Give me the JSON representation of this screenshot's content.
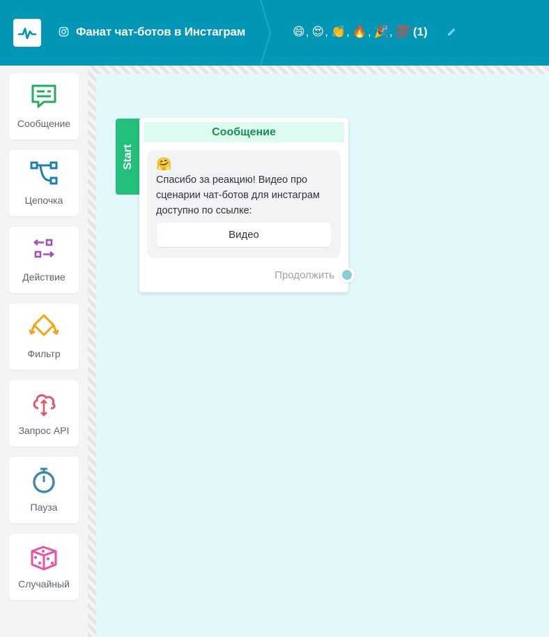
{
  "header": {
    "bot_title": "Фанат чат-ботов в Инстаграм",
    "trigger_emojis": [
      "😄",
      "😍",
      "👏",
      "🔥",
      "🎉",
      "💯"
    ],
    "trigger_count": "(1)"
  },
  "sidebar": {
    "items": [
      {
        "label": "Сообщение",
        "icon": "message-icon",
        "color": "#1eae5c"
      },
      {
        "label": "Цепочка",
        "icon": "chain-icon",
        "color": "#1a7fb5"
      },
      {
        "label": "Действие",
        "icon": "action-icon",
        "color": "#a14dc4"
      },
      {
        "label": "Фильтр",
        "icon": "filter-icon",
        "color": "#f5a20c"
      },
      {
        "label": "Запрос API",
        "icon": "api-icon",
        "color": "#e25466"
      },
      {
        "label": "Пауза",
        "icon": "timer-icon",
        "color": "#3e86ad"
      },
      {
        "label": "Случайный",
        "icon": "dice-icon",
        "color": "#ec4ea3"
      }
    ]
  },
  "node": {
    "start_label": "Start",
    "title": "Сообщение",
    "emoji": "🤗",
    "text": "Спасибо за реакцию! Видео про сценарии чат-ботов для инстаграм доступно по ссылке:",
    "button_label": "Видео",
    "continue_label": "Продолжить"
  },
  "colors": {
    "header_bg": "#0196b6",
    "canvas_bg": "#e3f8fb",
    "start_green": "#22c07a"
  }
}
